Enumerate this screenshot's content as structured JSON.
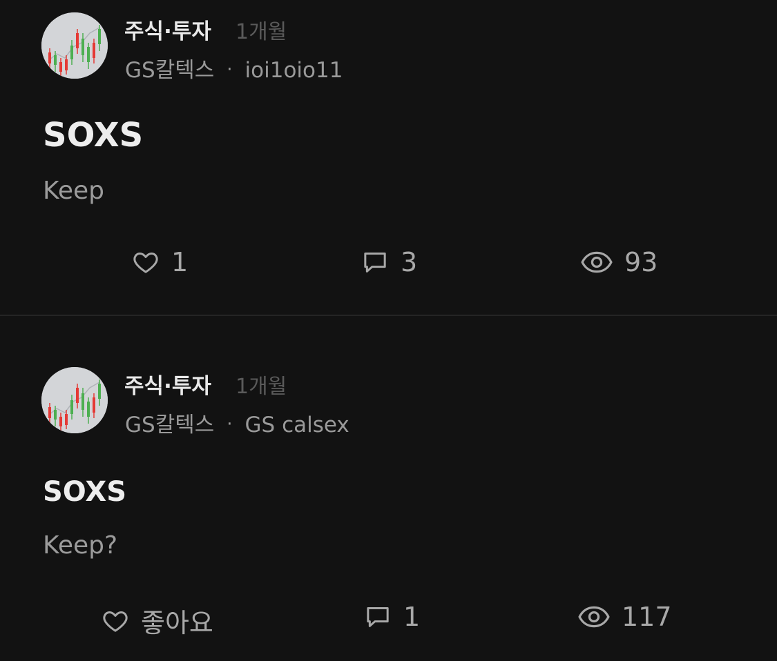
{
  "posts": [
    {
      "board": "주식·투자",
      "time": "1개월",
      "company": "GS칼텍스",
      "separator": "·",
      "author": "ioi1oio11",
      "title": "SOXS",
      "body": "Keep",
      "likes": "1",
      "comments": "3",
      "views": "93"
    },
    {
      "board": "주식·투자",
      "time": "1개월",
      "company": "GS칼텍스",
      "separator": "·",
      "author": "GS calsex",
      "title": "SOXS",
      "body": "Keep?",
      "likes": "좋아요",
      "comments": "1",
      "views": "117"
    }
  ],
  "colors": {
    "background": "#121212",
    "avatar_bg": "#d3d5d8",
    "candle_up": "#4caf50",
    "candle_down": "#e53935"
  },
  "icons": {
    "like": "heart-icon",
    "comment": "comment-bubble-icon",
    "view": "eye-icon"
  }
}
